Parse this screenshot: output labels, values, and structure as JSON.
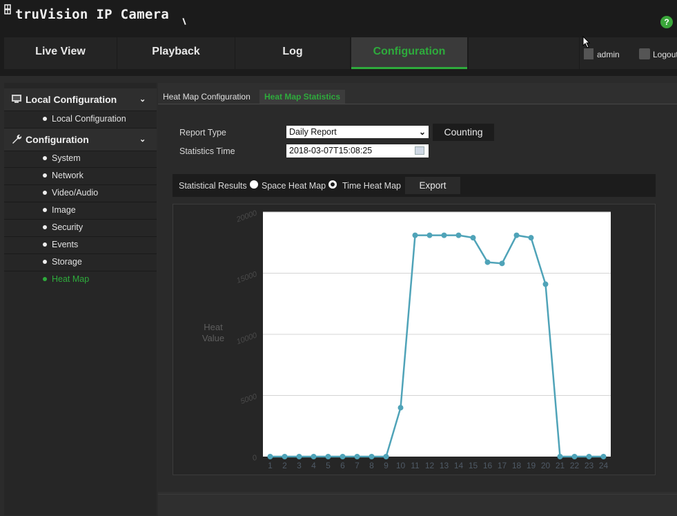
{
  "app": {
    "title": "truVision IP Camera",
    "help": "?"
  },
  "nav": {
    "tabs": [
      {
        "label": "Live View"
      },
      {
        "label": "Playback"
      },
      {
        "label": "Log"
      },
      {
        "label": "Configuration",
        "active": true
      }
    ],
    "user": "admin",
    "logout": "Logout"
  },
  "sidebar": {
    "local_header": "Local Configuration",
    "local_items": [
      "Local Configuration"
    ],
    "config_header": "Configuration",
    "config_items": [
      "System",
      "Network",
      "Video/Audio",
      "Image",
      "Security",
      "Events",
      "Storage",
      "Heat Map"
    ],
    "active_item": "Heat Map"
  },
  "subtabs": {
    "config": "Heat Map Configuration",
    "stats": "Heat Map Statistics"
  },
  "form": {
    "report_type_label": "Report Type",
    "report_type_value": "Daily Report",
    "counting_button": "Counting",
    "statistics_time_label": "Statistics Time",
    "statistics_time_value": "2018-03-07T15:08:25"
  },
  "results": {
    "label": "Statistical Results",
    "space_option": "Space Heat Map",
    "time_option": "Time Heat Map",
    "selected": "Time Heat Map",
    "export_button": "Export"
  },
  "colors": {
    "accent": "#2eab3c",
    "series": "#4fa3b8"
  },
  "chart_data": {
    "type": "line",
    "title": "",
    "ylabel": "Heat Value",
    "xlabel": "",
    "ylim": [
      0,
      20000
    ],
    "yticks": [
      "0",
      "5000",
      "10000",
      "15000",
      "20000"
    ],
    "grid": true,
    "x": [
      "1",
      "2",
      "3",
      "4",
      "5",
      "6",
      "7",
      "8",
      "9",
      "10",
      "11",
      "12",
      "13",
      "14",
      "15",
      "16",
      "17",
      "18",
      "19",
      "20",
      "21",
      "22",
      "23",
      "24"
    ],
    "series": [
      {
        "values": [
          0,
          0,
          0,
          0,
          0,
          0,
          0,
          0,
          0,
          4000,
          18100,
          18100,
          18100,
          18100,
          17900,
          15900,
          15800,
          18100,
          17900,
          14100,
          0,
          0,
          0,
          0
        ]
      }
    ]
  }
}
